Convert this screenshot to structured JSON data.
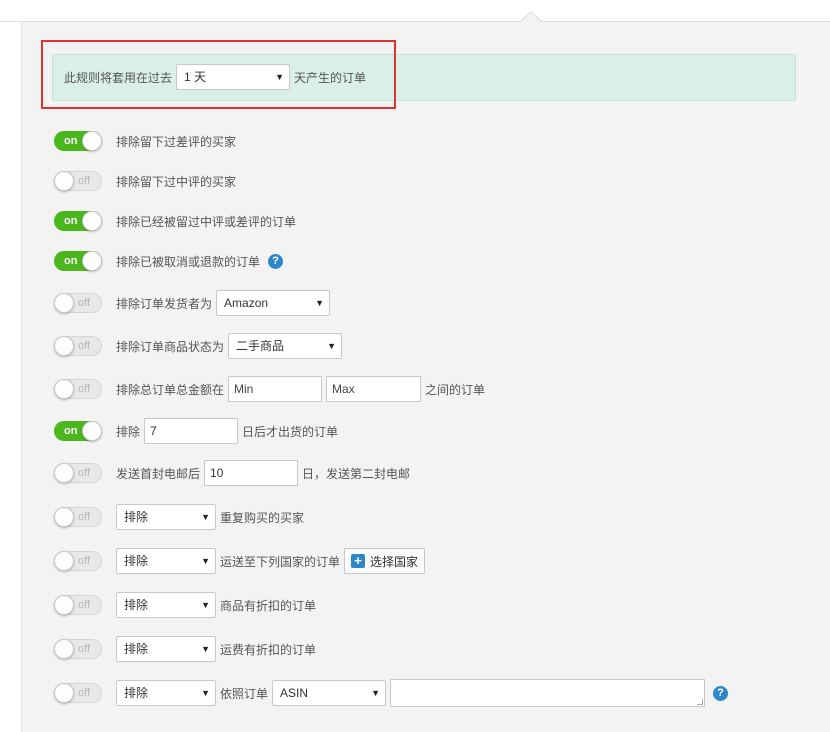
{
  "range": {
    "prefix": "此规则将套用在过去",
    "selected": "1 天",
    "suffix": "天产生的订单"
  },
  "colors": {
    "toggle_on": "#4cb61d",
    "range_bg": "#d9efe8",
    "highlight": "#e0322f",
    "help_icon": "#2d88c9"
  },
  "toggle_labels": {
    "on": "on",
    "off": "off"
  },
  "rules": {
    "r1": {
      "state": "on",
      "text": "排除留下过差评的买家"
    },
    "r2": {
      "state": "off",
      "text": "排除留下过中评的买家"
    },
    "r3": {
      "state": "on",
      "text": "排除已经被留过中评或差评的订单"
    },
    "r4": {
      "state": "on",
      "text": "排除已被取消或退款的订单"
    },
    "r5": {
      "state": "off",
      "text": "排除订单发货者为",
      "select": "Amazon"
    },
    "r6": {
      "state": "off",
      "text": "排除订单商品状态为",
      "select": "二手商品"
    },
    "r7": {
      "state": "off",
      "text": "排除总订单总金额在",
      "min_placeholder": "Min",
      "max_placeholder": "Max",
      "suffix": "之间的订单"
    },
    "r8": {
      "state": "on",
      "text": "排除",
      "value": "7",
      "suffix": "日后才出货的订单"
    },
    "r9": {
      "state": "off",
      "text": "发送首封电邮后",
      "value": "10",
      "suffix": "日，发送第二封电邮"
    },
    "r10": {
      "state": "off",
      "select": "排除",
      "text": "重复购买的买家"
    },
    "r11": {
      "state": "off",
      "select": "排除",
      "text": "运送至下列国家的订单",
      "button": "选择国家"
    },
    "r12": {
      "state": "off",
      "select": "排除",
      "text": "商品有折扣的订单"
    },
    "r13": {
      "state": "off",
      "select": "排除",
      "text": "运费有折扣的订单"
    },
    "r14": {
      "state": "off",
      "select": "排除",
      "text": "依照订单",
      "select2": "ASIN"
    }
  },
  "help_glyph": "?",
  "plus_glyph": "+",
  "caret_glyph": "▼"
}
